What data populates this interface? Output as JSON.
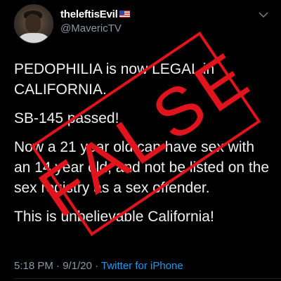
{
  "author": {
    "display_name": "theleftisEvil",
    "badge_icon": "us-flag-icon",
    "handle": "@MavericTV"
  },
  "tweet": {
    "paragraphs": [
      "PEDOPHILIA is now LEGAL in CALIFORNIA.",
      "SB-145 passed!",
      "Now a 21 year old can have sex with an 14 year old, and not be listed on the sex registry as a sex offender.",
      "This is unbelievable California!"
    ]
  },
  "meta": {
    "time": "5:18 PM",
    "separator": "·",
    "date": "9/1/20",
    "source": "Twitter for iPhone"
  },
  "stamp": {
    "label": "FALSE",
    "color": "#e0141c"
  },
  "colors": {
    "background": "#000000",
    "link": "#1d9bf0",
    "muted": "#8b98a5"
  }
}
